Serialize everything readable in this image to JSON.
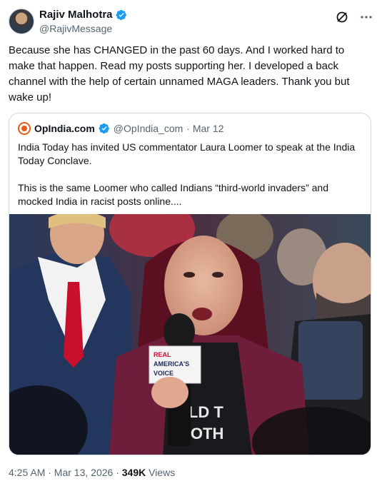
{
  "author": {
    "name": "Rajiv Malhotra",
    "handle": "@RajivMessage"
  },
  "post": {
    "text": "Because she has CHANGED in the past 60 days. And I worked hard to make that happen. Read my posts supporting her. I developed a back channel with the help of certain unnamed  MAGA leaders. Thank you but wake up!",
    "timestamp": "4:25 AM · Mar 13, 2026 · ",
    "views_count": "349K",
    "views_label": " Views"
  },
  "quote": {
    "name": "OpIndia.com",
    "handle": "@OpIndia_com",
    "date": " · Mar 12",
    "paragraph1": "India Today has invited US commentator Laura Loomer to speak at the India Today Conclave.",
    "paragraph2": "This is the same Loomer who called Indians “third-world invaders” and mocked India in racist posts online....",
    "photo": {
      "mic_flag_text_1": "REAL",
      "mic_flag_text_2": "AMERICA'S",
      "mic_flag_text_3": "VOICE",
      "shirt_text_1": "ALD T",
      "shirt_text_2": "NOTH"
    }
  },
  "icons": {
    "verified": "verified-badge-icon",
    "grok": "grok-icon",
    "more": "more-icon"
  },
  "colors": {
    "verified_blue": "#1d9bf0",
    "secondary_text": "#536471",
    "border": "#cfd9de",
    "opindia_orange": "#e85a1a"
  }
}
